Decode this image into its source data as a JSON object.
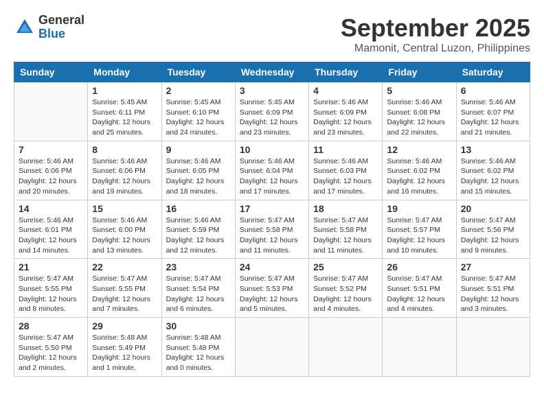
{
  "logo": {
    "general": "General",
    "blue": "Blue"
  },
  "title": "September 2025",
  "subtitle": "Mamonit, Central Luzon, Philippines",
  "weekdays": [
    "Sunday",
    "Monday",
    "Tuesday",
    "Wednesday",
    "Thursday",
    "Friday",
    "Saturday"
  ],
  "weeks": [
    [
      {
        "day": "",
        "info": ""
      },
      {
        "day": "1",
        "info": "Sunrise: 5:45 AM\nSunset: 6:11 PM\nDaylight: 12 hours\nand 25 minutes."
      },
      {
        "day": "2",
        "info": "Sunrise: 5:45 AM\nSunset: 6:10 PM\nDaylight: 12 hours\nand 24 minutes."
      },
      {
        "day": "3",
        "info": "Sunrise: 5:45 AM\nSunset: 6:09 PM\nDaylight: 12 hours\nand 23 minutes."
      },
      {
        "day": "4",
        "info": "Sunrise: 5:46 AM\nSunset: 6:09 PM\nDaylight: 12 hours\nand 23 minutes."
      },
      {
        "day": "5",
        "info": "Sunrise: 5:46 AM\nSunset: 6:08 PM\nDaylight: 12 hours\nand 22 minutes."
      },
      {
        "day": "6",
        "info": "Sunrise: 5:46 AM\nSunset: 6:07 PM\nDaylight: 12 hours\nand 21 minutes."
      }
    ],
    [
      {
        "day": "7",
        "info": "Sunrise: 5:46 AM\nSunset: 6:06 PM\nDaylight: 12 hours\nand 20 minutes."
      },
      {
        "day": "8",
        "info": "Sunrise: 5:46 AM\nSunset: 6:06 PM\nDaylight: 12 hours\nand 19 minutes."
      },
      {
        "day": "9",
        "info": "Sunrise: 5:46 AM\nSunset: 6:05 PM\nDaylight: 12 hours\nand 18 minutes."
      },
      {
        "day": "10",
        "info": "Sunrise: 5:46 AM\nSunset: 6:04 PM\nDaylight: 12 hours\nand 17 minutes."
      },
      {
        "day": "11",
        "info": "Sunrise: 5:46 AM\nSunset: 6:03 PM\nDaylight: 12 hours\nand 17 minutes."
      },
      {
        "day": "12",
        "info": "Sunrise: 5:46 AM\nSunset: 6:02 PM\nDaylight: 12 hours\nand 16 minutes."
      },
      {
        "day": "13",
        "info": "Sunrise: 5:46 AM\nSunset: 6:02 PM\nDaylight: 12 hours\nand 15 minutes."
      }
    ],
    [
      {
        "day": "14",
        "info": "Sunrise: 5:46 AM\nSunset: 6:01 PM\nDaylight: 12 hours\nand 14 minutes."
      },
      {
        "day": "15",
        "info": "Sunrise: 5:46 AM\nSunset: 6:00 PM\nDaylight: 12 hours\nand 13 minutes."
      },
      {
        "day": "16",
        "info": "Sunrise: 5:46 AM\nSunset: 5:59 PM\nDaylight: 12 hours\nand 12 minutes."
      },
      {
        "day": "17",
        "info": "Sunrise: 5:47 AM\nSunset: 5:58 PM\nDaylight: 12 hours\nand 11 minutes."
      },
      {
        "day": "18",
        "info": "Sunrise: 5:47 AM\nSunset: 5:58 PM\nDaylight: 12 hours\nand 11 minutes."
      },
      {
        "day": "19",
        "info": "Sunrise: 5:47 AM\nSunset: 5:57 PM\nDaylight: 12 hours\nand 10 minutes."
      },
      {
        "day": "20",
        "info": "Sunrise: 5:47 AM\nSunset: 5:56 PM\nDaylight: 12 hours\nand 9 minutes."
      }
    ],
    [
      {
        "day": "21",
        "info": "Sunrise: 5:47 AM\nSunset: 5:55 PM\nDaylight: 12 hours\nand 8 minutes."
      },
      {
        "day": "22",
        "info": "Sunrise: 5:47 AM\nSunset: 5:55 PM\nDaylight: 12 hours\nand 7 minutes."
      },
      {
        "day": "23",
        "info": "Sunrise: 5:47 AM\nSunset: 5:54 PM\nDaylight: 12 hours\nand 6 minutes."
      },
      {
        "day": "24",
        "info": "Sunrise: 5:47 AM\nSunset: 5:53 PM\nDaylight: 12 hours\nand 5 minutes."
      },
      {
        "day": "25",
        "info": "Sunrise: 5:47 AM\nSunset: 5:52 PM\nDaylight: 12 hours\nand 4 minutes."
      },
      {
        "day": "26",
        "info": "Sunrise: 5:47 AM\nSunset: 5:51 PM\nDaylight: 12 hours\nand 4 minutes."
      },
      {
        "day": "27",
        "info": "Sunrise: 5:47 AM\nSunset: 5:51 PM\nDaylight: 12 hours\nand 3 minutes."
      }
    ],
    [
      {
        "day": "28",
        "info": "Sunrise: 5:47 AM\nSunset: 5:50 PM\nDaylight: 12 hours\nand 2 minutes."
      },
      {
        "day": "29",
        "info": "Sunrise: 5:48 AM\nSunset: 5:49 PM\nDaylight: 12 hours\nand 1 minute."
      },
      {
        "day": "30",
        "info": "Sunrise: 5:48 AM\nSunset: 5:48 PM\nDaylight: 12 hours\nand 0 minutes."
      },
      {
        "day": "",
        "info": ""
      },
      {
        "day": "",
        "info": ""
      },
      {
        "day": "",
        "info": ""
      },
      {
        "day": "",
        "info": ""
      }
    ]
  ]
}
